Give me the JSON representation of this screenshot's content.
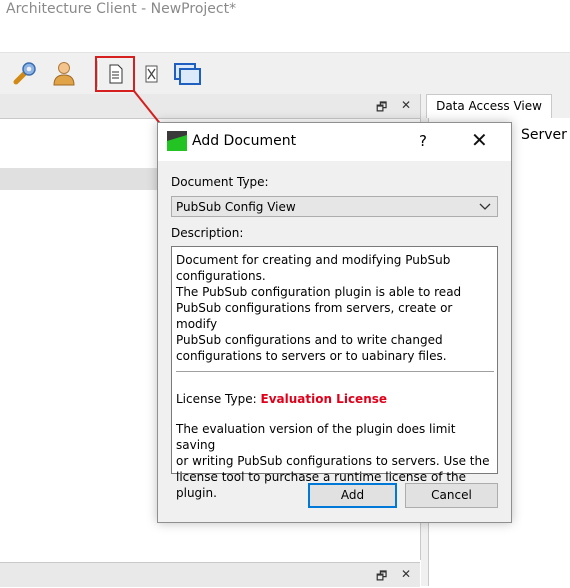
{
  "window": {
    "title": "Architecture Client - NewProject*"
  },
  "toolbar": {
    "items": [
      {
        "icon": "wrench-icon"
      },
      {
        "icon": "user-icon"
      },
      {
        "icon": "new-document-icon"
      },
      {
        "icon": "delete-document-icon"
      },
      {
        "icon": "windows-icon"
      }
    ]
  },
  "panes": {
    "left_controls": [
      "🗗",
      "✕"
    ],
    "right_tab": "Data Access View",
    "right_content_label": "Server"
  },
  "dialog": {
    "title": "Add Document",
    "help": "?",
    "close": "✕",
    "doc_type_label": "Document Type:",
    "doc_type_value": "PubSub Config View",
    "description_label": "Description:",
    "description_text": "Document for creating and modifying PubSub\nconfigurations.\nThe PubSub configuration plugin is able to read\nPubSub configurations from servers, create or modify\nPubSub configurations and to write changed\nconfigurations to servers or to uabinary files.",
    "license_label": "License Type:",
    "license_type": "Evaluation License",
    "license_text": "The evaluation version of the plugin does limit saving\nor writing PubSub configurations to servers. Use the\nlicense tool to purchase a runtime license of the plugin.",
    "add_button": "Add",
    "cancel_button": "Cancel"
  },
  "colors": {
    "accent": "#0078d7",
    "highlight": "#d61f1f",
    "license": "#e0001a"
  }
}
